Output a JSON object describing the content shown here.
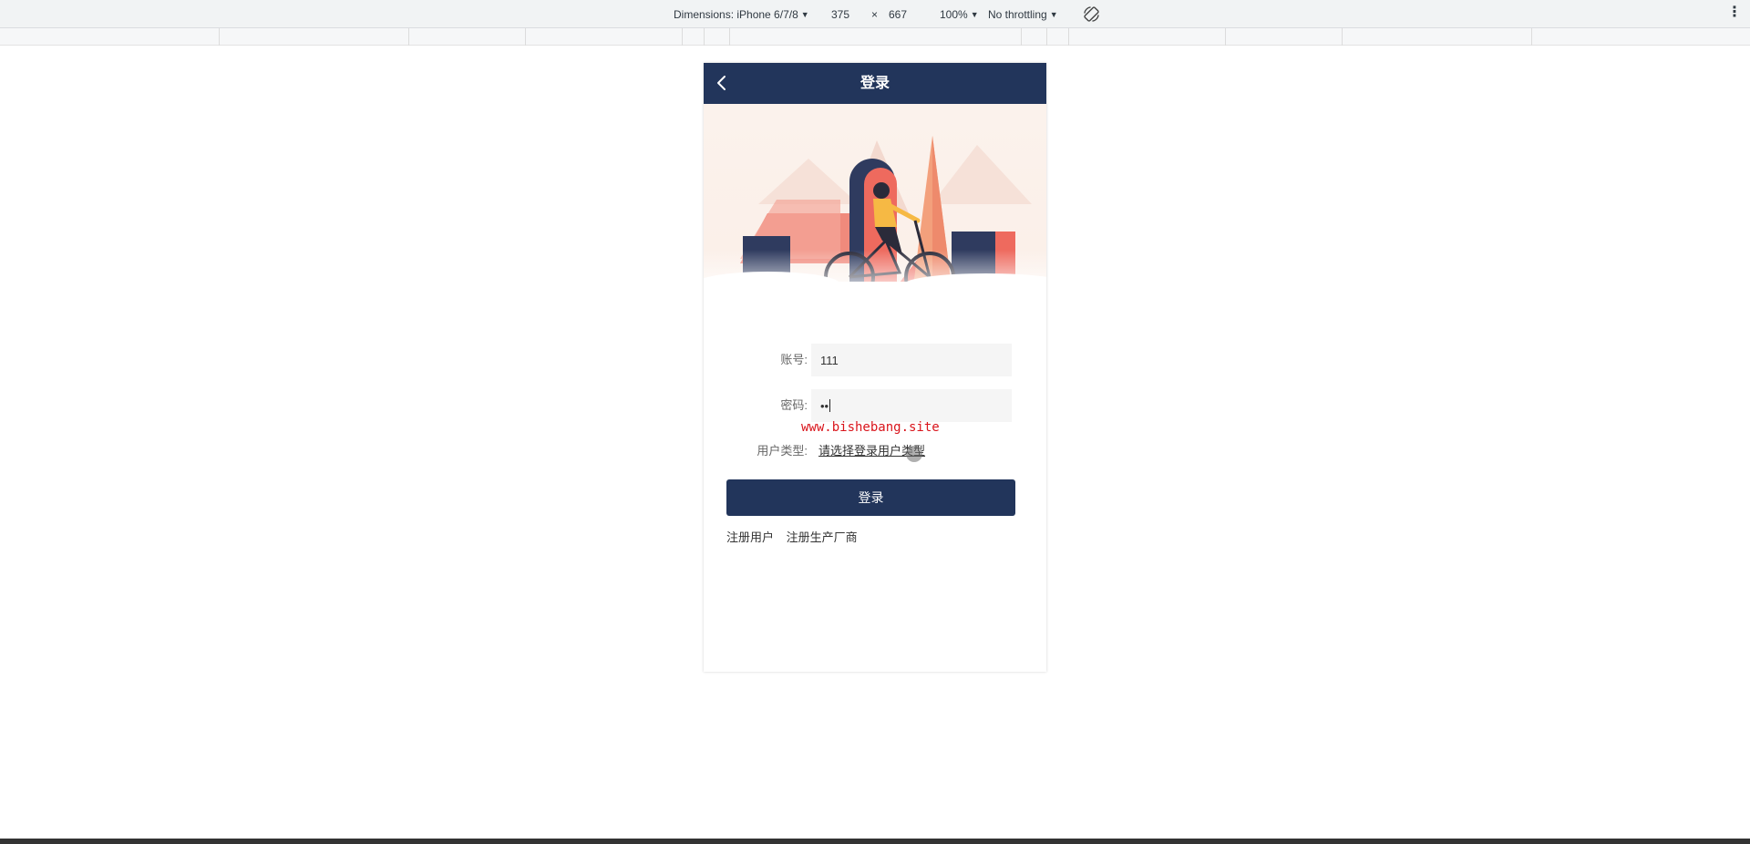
{
  "devtools": {
    "dimensions_label": "Dimensions: iPhone 6/7/8",
    "width": "375",
    "times": "×",
    "height": "667",
    "zoom": "100%",
    "throttling": "No throttling"
  },
  "page": {
    "title": "登录",
    "banner_icon": "cyclist-illustration",
    "account_label": "账号:",
    "account_value": "111",
    "password_label": "密码:",
    "password_value": "••",
    "user_type_label": "用户类型:",
    "user_type_placeholder": "请选择登录用户类型",
    "login_button": "登录",
    "register_user": "注册用户",
    "register_manufacturer": "注册生产厂商"
  },
  "watermark": "www.bishebang.site",
  "colors": {
    "nav": "#22355b",
    "accent": "#22355b",
    "watermark": "#d9141b"
  }
}
